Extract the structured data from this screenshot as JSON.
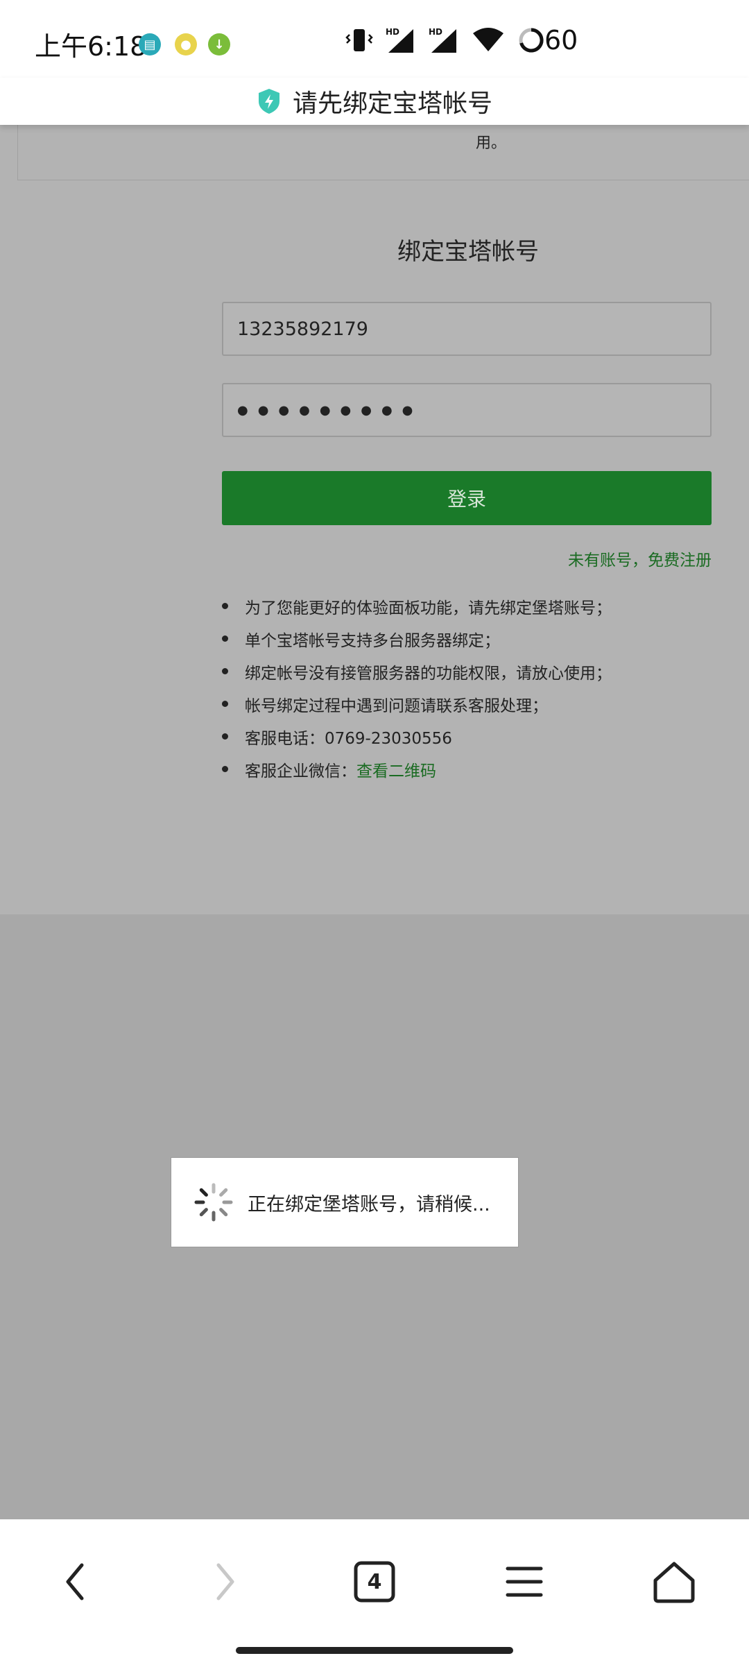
{
  "status_bar": {
    "time": "上午6:18",
    "battery_level": "60",
    "notification_icons": [
      "message-icon",
      "coin-icon",
      "download-icon"
    ],
    "indicators": [
      "vibrate-icon",
      "signal-hd-1-icon",
      "signal-hd-2-icon",
      "wifi-icon",
      "battery-ring-icon"
    ]
  },
  "title_bar": {
    "title": "请先绑定宝塔帐号",
    "icon": "shield-bolt-icon",
    "icon_color": "#3dc8b5"
  },
  "page": {
    "notice_tail": "用。",
    "bind_title": "绑定宝塔帐号",
    "phone_value": "13235892179",
    "password_value": "●●●●●●●●●",
    "login_label": "登录",
    "register_link": "未有账号，免费注册",
    "info_items": [
      "为了您能更好的体验面板功能，请先绑定堡塔账号；",
      "单个宝塔帐号支持多台服务器绑定；",
      "绑定帐号没有接管服务器的功能权限，请放心使用；",
      "帐号绑定过程中遇到问题请联系客服处理；",
      "客服电话：0769-23030556"
    ],
    "wechat_label": "客服企业微信：",
    "wechat_link": "查看二维码",
    "accent_color": "#1a7a29"
  },
  "toast": {
    "message": "正在绑定堡塔账号，请稍候..."
  },
  "bottom_nav": {
    "tab_count": "4",
    "buttons": [
      "back-icon",
      "forward-icon",
      "tabs-icon",
      "menu-icon",
      "home-icon"
    ]
  }
}
